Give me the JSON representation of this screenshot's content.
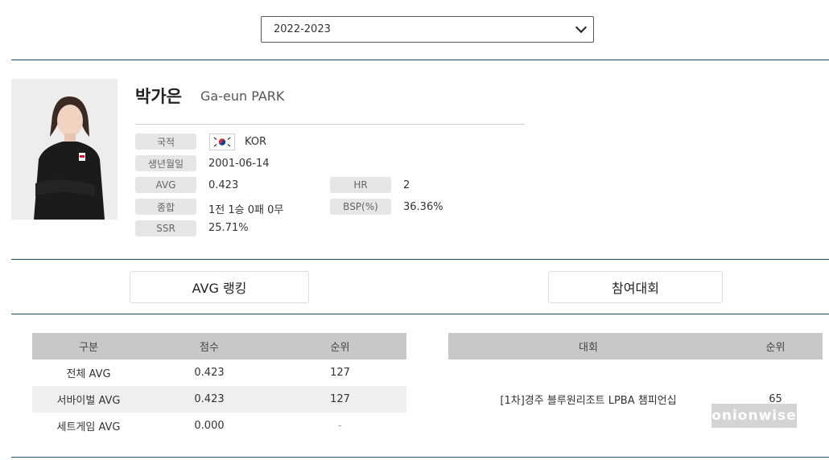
{
  "season": {
    "selected": "2022-2023"
  },
  "player": {
    "name_ko": "박가은",
    "name_en": "Ga-eun PARK",
    "fields": {
      "nationality": {
        "label": "국적",
        "value": "KOR"
      },
      "birth": {
        "label": "생년월일",
        "value": "2001-06-14"
      },
      "avg": {
        "label": "AVG",
        "value": "0.423"
      },
      "hr": {
        "label": "HR",
        "value": "2"
      },
      "overall": {
        "label": "종합",
        "value": "1전 1승 0패 0무"
      },
      "bsp": {
        "label": "BSP(%)",
        "value": "36.36%"
      },
      "ssr": {
        "label": "SSR",
        "value": "25.71%"
      }
    }
  },
  "tabs": {
    "avg_ranking": "AVG 랭킹",
    "tournaments": "참여대회"
  },
  "ranking_table": {
    "headers": [
      "구분",
      "점수",
      "순위"
    ],
    "rows": [
      [
        "전체 AVG",
        "0.423",
        "127"
      ],
      [
        "서바이벌 AVG",
        "0.423",
        "127"
      ],
      [
        "세트게임 AVG",
        "0.000",
        "-"
      ]
    ]
  },
  "tournament_table": {
    "headers": [
      "대회",
      "순위"
    ],
    "rows": [
      [
        "[1차]경주 블루원리조트 LPBA 챔피언십",
        "65"
      ]
    ]
  },
  "watermark": "onionwise"
}
